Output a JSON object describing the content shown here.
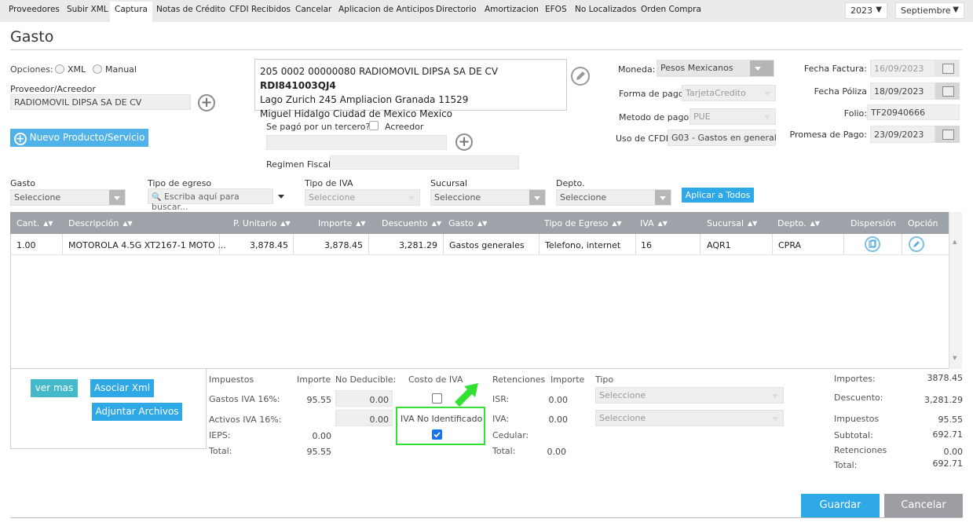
{
  "nav": {
    "items": [
      "Proveedores",
      "Subir XML",
      "Captura",
      "Notas de Crédito",
      "CFDI Recibidos",
      "Cancelar",
      "Aplicacion de Anticipos",
      "Directorio",
      "Amortizacion",
      "EFOS",
      "No Localizados",
      "Orden Compra"
    ],
    "active": "Captura",
    "year": "2023",
    "month": "Septiembre"
  },
  "page_title": "Gasto",
  "opciones": {
    "label": "Opciones:",
    "xml": "XML",
    "manual": "Manual"
  },
  "proveedor": {
    "label": "Proveedor/Acreedor",
    "value": "RADIOMOVIL DIPSA SA DE CV"
  },
  "address": {
    "line1_prefix": "205 0002 00000080 RADIOMOVIL DIPSA SA DE CV ",
    "rfc": "RDI841003QJ4",
    "line2": "Lago Zurich 245 Ampliacion Granada 11529",
    "line3": "Miguel Hidalgo Ciudad de Mexico Mexico"
  },
  "nuevo_producto": "Nuevo Producto/Servicio",
  "tercero": {
    "label": "Se pagó por un tercero?",
    "acreedor": "Acreedor",
    "regimen_label": "Regimen Fiscal:"
  },
  "moneda": {
    "label": "Moneda:",
    "value": "Pesos Mexicanos"
  },
  "forma_pago": {
    "label": "Forma de pago",
    "value": "TarjetaCredito"
  },
  "metodo_pago": {
    "label": "Metodo de pago:",
    "value": "PUE"
  },
  "uso_cfdi": {
    "label": "Uso de CFDI",
    "value": "G03 - Gastos en general"
  },
  "fecha_factura": {
    "label": "Fecha Factura:",
    "value": "16/09/2023"
  },
  "fecha_poliza": {
    "label": "Fecha Póliza",
    "value": "18/09/2023"
  },
  "folio": {
    "label": "Folio:",
    "value": "TF20940666"
  },
  "promesa_pago": {
    "label": "Promesa de Pago:",
    "value": "23/09/2023"
  },
  "filters": {
    "gasto": {
      "label": "Gasto",
      "value": "Seleccione"
    },
    "tipo_egreso": {
      "label": "Tipo de egreso",
      "placeholder": "Escriba aquí para buscar..."
    },
    "tipo_iva": {
      "label": "Tipo de IVA",
      "value": "Seleccione"
    },
    "sucursal": {
      "label": "Sucursal",
      "value": "Seleccione"
    },
    "depto": {
      "label": "Depto.",
      "value": "Seleccione"
    },
    "aplicar": "Aplicar a Todos"
  },
  "table": {
    "headers": [
      "Cant.",
      "Descripción",
      "P. Unitario",
      "Importe",
      "Descuento",
      "Gasto",
      "Tipo de Egreso",
      "IVA",
      "Sucursal",
      "Depto.",
      "Dispersión",
      "Opción"
    ],
    "row": {
      "cant": "1.00",
      "descripcion": "MOTOROLA 4.5G XT2167-1 MOTO ...",
      "p_unitario": "3,878.45",
      "importe": "3,878.45",
      "descuento": "3,281.29",
      "gasto": "Gastos generales",
      "tipo_egreso": "Telefono, internet",
      "iva": "16",
      "sucursal": "AQR1",
      "depto": "CPRA"
    }
  },
  "buttons": {
    "ver_mas": "ver mas",
    "asociar": "Asociar Xml",
    "adjuntar": "Adjuntar Archivos",
    "guardar": "Guardar",
    "cancelar": "Cancelar"
  },
  "impuestos": {
    "header": "Impuestos",
    "importe_h": "Importe",
    "no_deducible_h": "No Deducible:",
    "costo_iva_h": "Costo de IVA",
    "gastos_iva_label": "Gastos IVA 16%:",
    "gastos_iva_importe": "95.55",
    "gastos_iva_nd": "0.00",
    "activos_iva_label": "Activos IVA 16%:",
    "activos_iva_nd": "0.00",
    "ieps_label": "IEPS:",
    "ieps_value": "0.00",
    "total_label": "Total:",
    "total_value": "95.55",
    "iva_no_identificado": "IVA No Identificado",
    "iva_no_identificado_checked": true
  },
  "retenciones": {
    "header": "Retenciones",
    "importe_h": "Importe",
    "tipo_h": "Tipo",
    "isr_label": "ISR:",
    "isr_value": "0.00",
    "isr_tipo": "Seleccione",
    "iva_label": "IVA:",
    "iva_value": "0.00",
    "iva_tipo": "Seleccione",
    "cedular_label": "Cedular:",
    "total_label": "Total:",
    "total_value": "0.00"
  },
  "totales": {
    "importes_label": "Importes:",
    "importes_value": "3878.45",
    "descuento_label": "Descuento:",
    "descuento_value": "3,281.29",
    "impuestos_label": "Impuestos",
    "impuestos_value": "95.55",
    "subtotal_label": "Subtotal:",
    "subtotal_value": "692.71",
    "retenciones_label": "Retenciones",
    "retenciones_value": "0.00",
    "total_label": "Total:",
    "total_value": "692.71"
  },
  "colors": {
    "accent_blue": "#2ea8e6",
    "teal": "#45b8c9",
    "highlight_green": "#33e133",
    "table_header": "#9ea3aa"
  }
}
